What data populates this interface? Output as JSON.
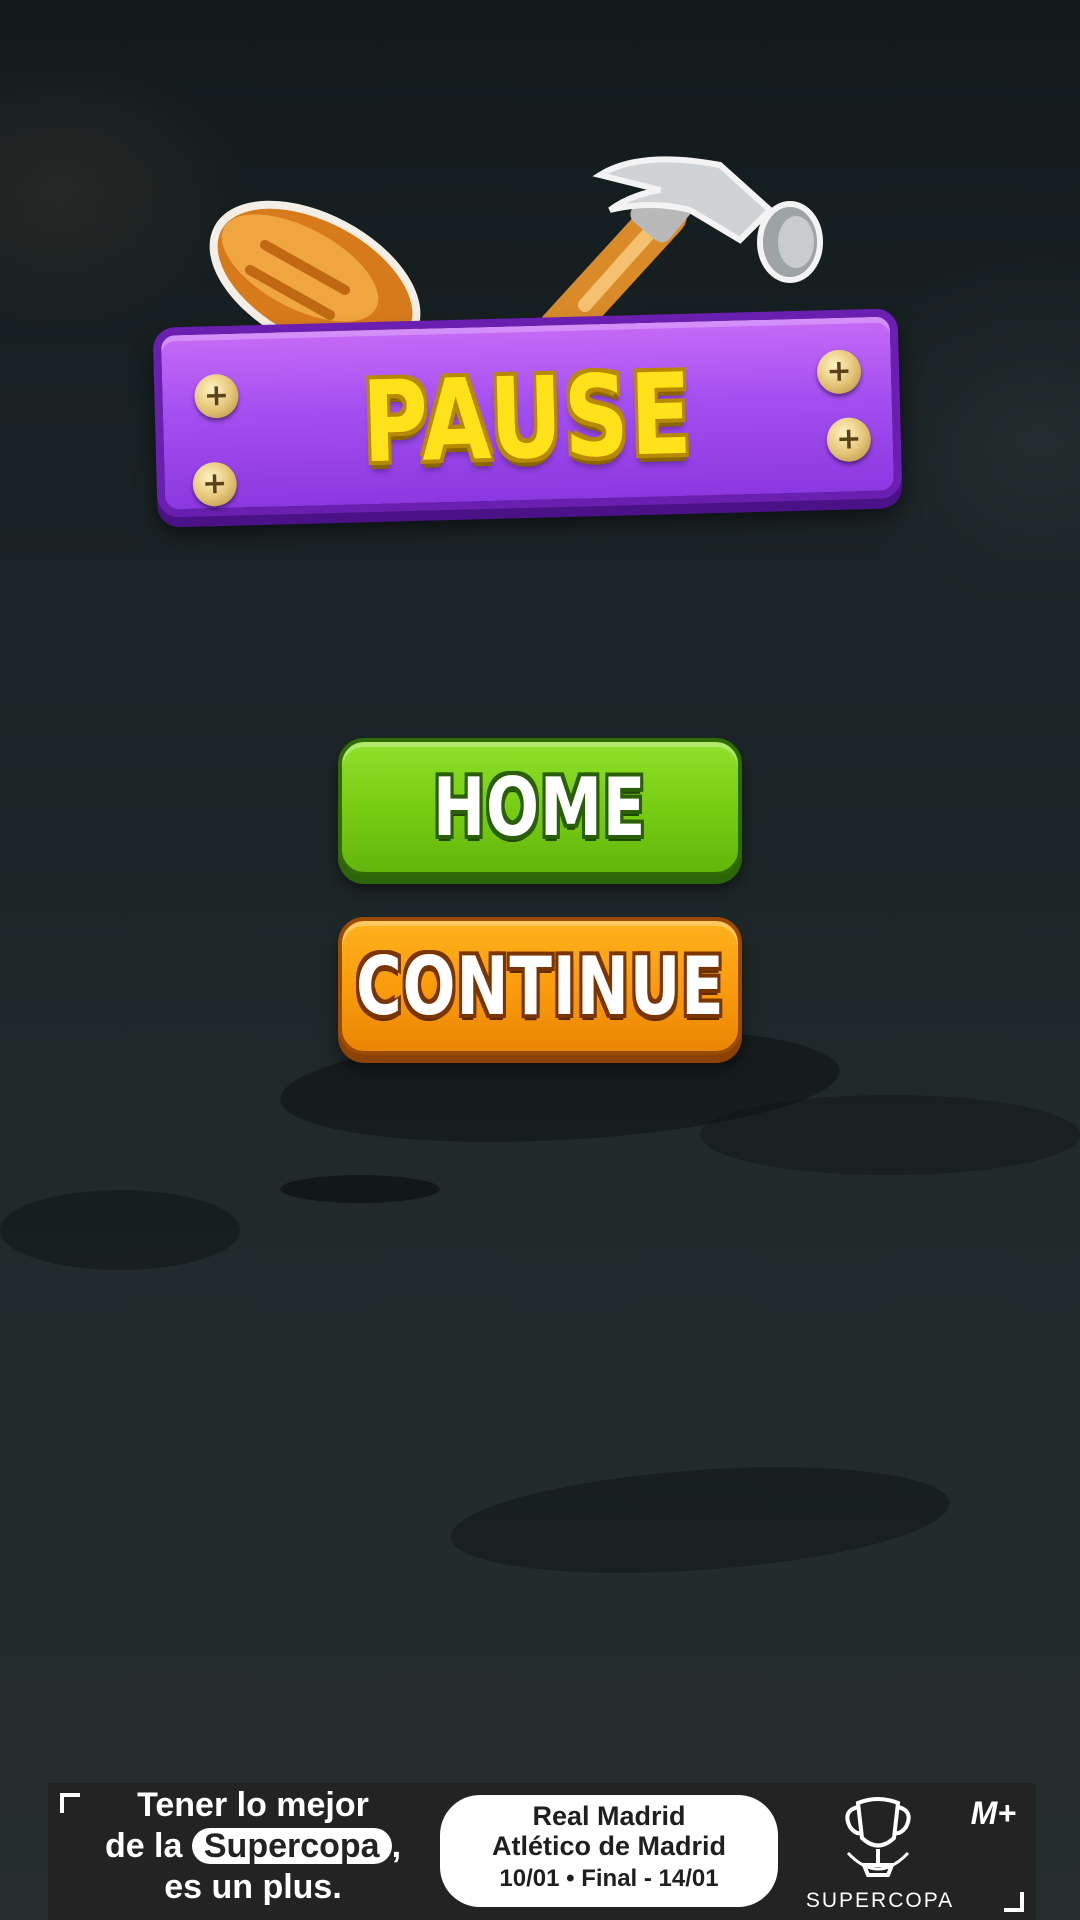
{
  "pause_panel": {
    "title": "PAUSE"
  },
  "buttons": {
    "home_label": "HOME",
    "continue_label": "CONTINUE"
  },
  "icons": [
    "screwdriver-icon",
    "hammer-icon",
    "screw-icon"
  ],
  "colors": {
    "banner_purple": "#a44ff0",
    "title_yellow": "#ffe21a",
    "home_green": "#76cc12",
    "continue_orange": "#f89a0c"
  },
  "ad": {
    "line1": "Tener lo mejor",
    "line2_pre": "de la",
    "line2_highlight": "Supercopa",
    "line2_post": ",",
    "line3": "es un plus.",
    "match_team1": "Real Madrid",
    "match_team2": "Atlético de Madrid",
    "match_dates": "10/01  •  Final - 14/01",
    "logo_text": "SUPERCOPA",
    "brand": "M+"
  }
}
